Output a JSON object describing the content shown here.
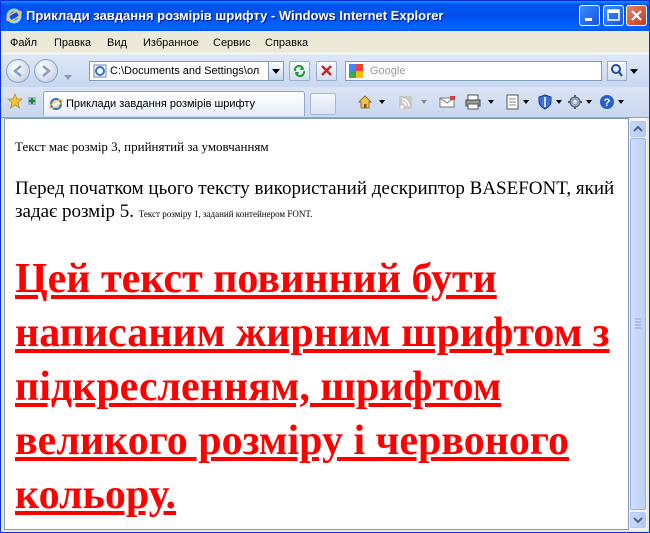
{
  "window": {
    "title": "Приклади завдання розмірів шрифту - Windows Internet Explorer"
  },
  "menu": {
    "items": [
      "Файл",
      "Правка",
      "Вид",
      "Избранное",
      "Сервис",
      "Справка"
    ]
  },
  "address": {
    "value": "C:\\Documents and Settings\\оля"
  },
  "search": {
    "placeholder": "Google"
  },
  "tab": {
    "label": "Приклади завдання розмірів шрифту"
  },
  "content": {
    "p1": "Текст має розмір 3, прийнятий за умовчанням",
    "p2": "Перед початком цього тексту використаний дескриптор BASEFONT, який задає розмір 5.",
    "p2_small": "Текст розміру 1, заданий контейнером FONT.",
    "p3": "Цей текст повинний бути написаним жирним шрифтом з підкресленням, шрифтом великого розміру і червоного кольору.",
    "p3_color": "#ff0000"
  },
  "colors": {
    "titlebar": "#0054e3",
    "menubar": "#ece9d8"
  },
  "icons": [
    "ie-icon",
    "minimize-icon",
    "maximize-icon",
    "close-icon",
    "back-icon",
    "forward-icon",
    "page-icon",
    "refresh-icon",
    "stop-icon",
    "google-icon",
    "search-icon",
    "favorites-star-icon",
    "add-favorites-icon",
    "home-icon",
    "feeds-icon",
    "mail-icon",
    "print-icon",
    "page-menu-icon",
    "safety-icon",
    "tools-icon",
    "help-icon"
  ]
}
